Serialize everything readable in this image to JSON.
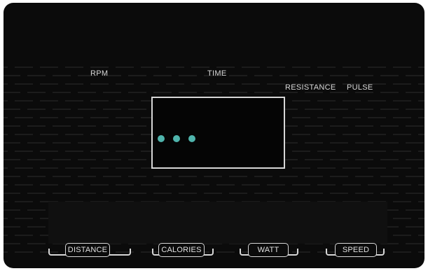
{
  "console": {
    "labels": {
      "rpm": "RPM",
      "time": "TIME",
      "resistance": "RESISTANCE",
      "pulse": "PULSE"
    },
    "display": {
      "indicator_color": "#4fb4ac",
      "indicator_count": 3
    },
    "buttons": {
      "distance": "DISTANCE",
      "calories": "CALORIES",
      "watt": "WATT",
      "speed": "SPEED"
    }
  }
}
